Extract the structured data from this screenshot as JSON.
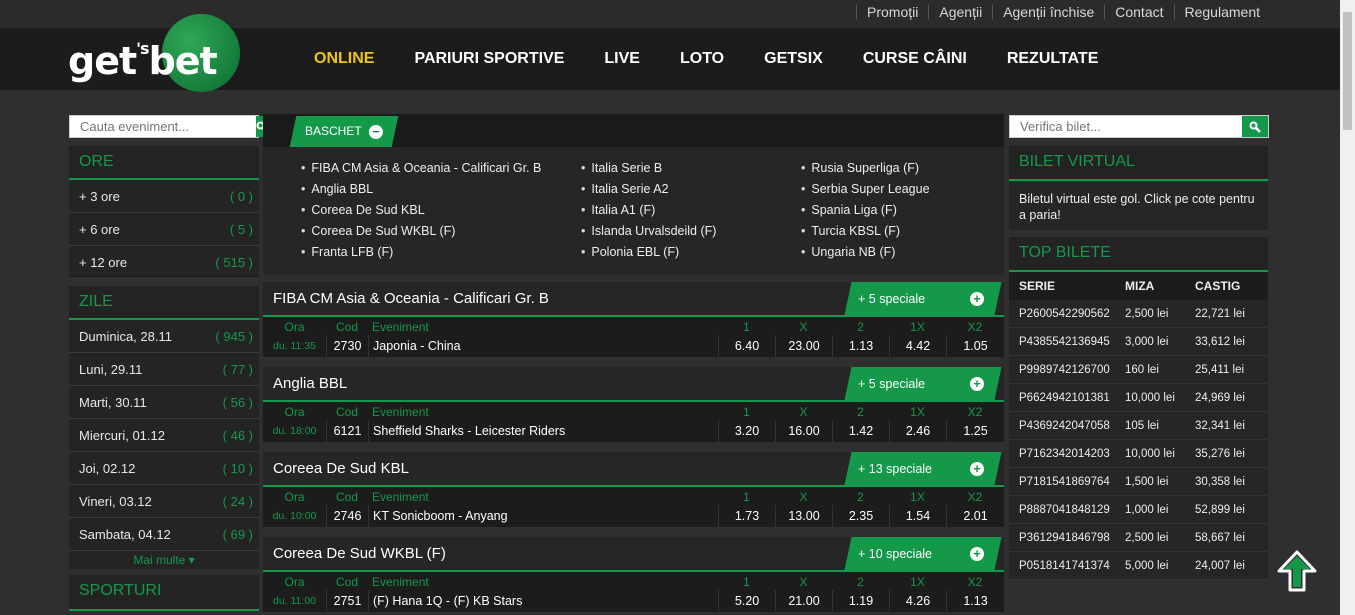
{
  "toplinks": [
    "Promoții",
    "Agenții",
    "Agenții închise",
    "Contact",
    "Regulament"
  ],
  "logo": {
    "part1": "get",
    "apos": "'s",
    "part2": "bet"
  },
  "nav": [
    "ONLINE",
    "PARIURI SPORTIVE",
    "LIVE",
    "LOTO",
    "GETSIX",
    "CURSE CÂINI",
    "REZULTATE"
  ],
  "search_event": {
    "placeholder": "Cauta eveniment..."
  },
  "search_ticket": {
    "placeholder": "Verifica bilet..."
  },
  "ore": {
    "title": "ORE",
    "items": [
      {
        "label": "+ 3 ore",
        "count": "( 0 )"
      },
      {
        "label": "+ 6 ore",
        "count": "( 5 )"
      },
      {
        "label": "+ 12 ore",
        "count": "( 515 )"
      }
    ]
  },
  "zile": {
    "title": "ZILE",
    "items": [
      {
        "label": "Duminica, 28.11",
        "count": "( 945 )"
      },
      {
        "label": "Luni, 29.11",
        "count": "( 77 )"
      },
      {
        "label": "Marti, 30.11",
        "count": "( 56 )"
      },
      {
        "label": "Miercuri, 01.12",
        "count": "( 46 )"
      },
      {
        "label": "Joi, 02.12",
        "count": "( 10 )"
      },
      {
        "label": "Vineri, 03.12",
        "count": "( 24 )"
      },
      {
        "label": "Sambata, 04.12",
        "count": "( 69 )"
      }
    ],
    "more": "Mai multe ▾"
  },
  "sporturi": {
    "title": "SPORTURI"
  },
  "sport_tab": "BASCHET",
  "leagues": [
    [
      "FIBA CM Asia & Oceania - Calificari Gr. B",
      "Anglia BBL",
      "Coreea De Sud KBL",
      "Coreea De Sud WKBL (F)",
      "Franta LFB (F)"
    ],
    [
      "Italia Serie B",
      "Italia Serie A2",
      "Italia A1 (F)",
      "Islanda Urvalsdeild (F)",
      "Polonia EBL (F)"
    ],
    [
      "Rusia Superliga (F)",
      "Serbia Super League",
      "Spania Liga (F)",
      "Turcia KBSL (F)",
      "Ungaria NB (F)"
    ]
  ],
  "col_headers": {
    "ora": "Ora",
    "cod": "Cod",
    "ev": "Eveniment",
    "o1": "1",
    "ox": "X",
    "o2": "2",
    "o1x": "1X",
    "ox2": "X2"
  },
  "blocks": [
    {
      "title": "FIBA CM Asia & Oceania - Calificari Gr. B",
      "speciale": "+ 5 speciale",
      "row": {
        "ora": "du. 11:35",
        "cod": "2730",
        "ev": "Japonia - China",
        "o1": "6.40",
        "ox": "23.00",
        "o2": "1.13",
        "o1x": "4.42",
        "ox2": "1.05"
      }
    },
    {
      "title": "Anglia BBL",
      "speciale": "+ 5 speciale",
      "row": {
        "ora": "du. 18:00",
        "cod": "6121",
        "ev": "Sheffield Sharks - Leicester Riders",
        "o1": "3.20",
        "ox": "16.00",
        "o2": "1.42",
        "o1x": "2.46",
        "ox2": "1.25"
      }
    },
    {
      "title": "Coreea De Sud KBL",
      "speciale": "+ 13 speciale",
      "row": {
        "ora": "du. 10:00",
        "cod": "2746",
        "ev": "KT Sonicboom - Anyang",
        "o1": "1.73",
        "ox": "13.00",
        "o2": "2.35",
        "o1x": "1.54",
        "ox2": "2.01"
      }
    },
    {
      "title": "Coreea De Sud WKBL (F)",
      "speciale": "+ 10 speciale",
      "row": {
        "ora": "du. 11:00",
        "cod": "2751",
        "ev": "(F) Hana 1Q - (F) KB Stars",
        "o1": "5.20",
        "ox": "21.00",
        "o2": "1.19",
        "o1x": "4.26",
        "ox2": "1.13"
      }
    }
  ],
  "bilet_virtual": {
    "title": "BILET VIRTUAL",
    "text": "Biletul virtual este gol. Click pe cote pentru a paria!"
  },
  "top_bilete": {
    "title": "TOP BILETE",
    "headers": [
      "SERIE",
      "MIZA",
      "CASTIG"
    ],
    "rows": [
      [
        "P2600542290562",
        "2,500 lei",
        "22,721 lei"
      ],
      [
        "P4385542136945",
        "3,000 lei",
        "33,612 lei"
      ],
      [
        "P9989742126700",
        "160 lei",
        "25,411 lei"
      ],
      [
        "P6624942101381",
        "10,000 lei",
        "24,969 lei"
      ],
      [
        "P4369242047058",
        "105 lei",
        "32,341 lei"
      ],
      [
        "P7162342014203",
        "10,000 lei",
        "35,276 lei"
      ],
      [
        "P7181541869764",
        "1,500 lei",
        "30,358 lei"
      ],
      [
        "P8887041848129",
        "1,000 lei",
        "52,899 lei"
      ],
      [
        "P3612941846798",
        "2,500 lei",
        "58,667 lei"
      ],
      [
        "P0518141741374",
        "5,000 lei",
        "24,007 lei"
      ]
    ]
  },
  "colors": {
    "accent": "#14994a",
    "nav_active": "#f0c419"
  }
}
